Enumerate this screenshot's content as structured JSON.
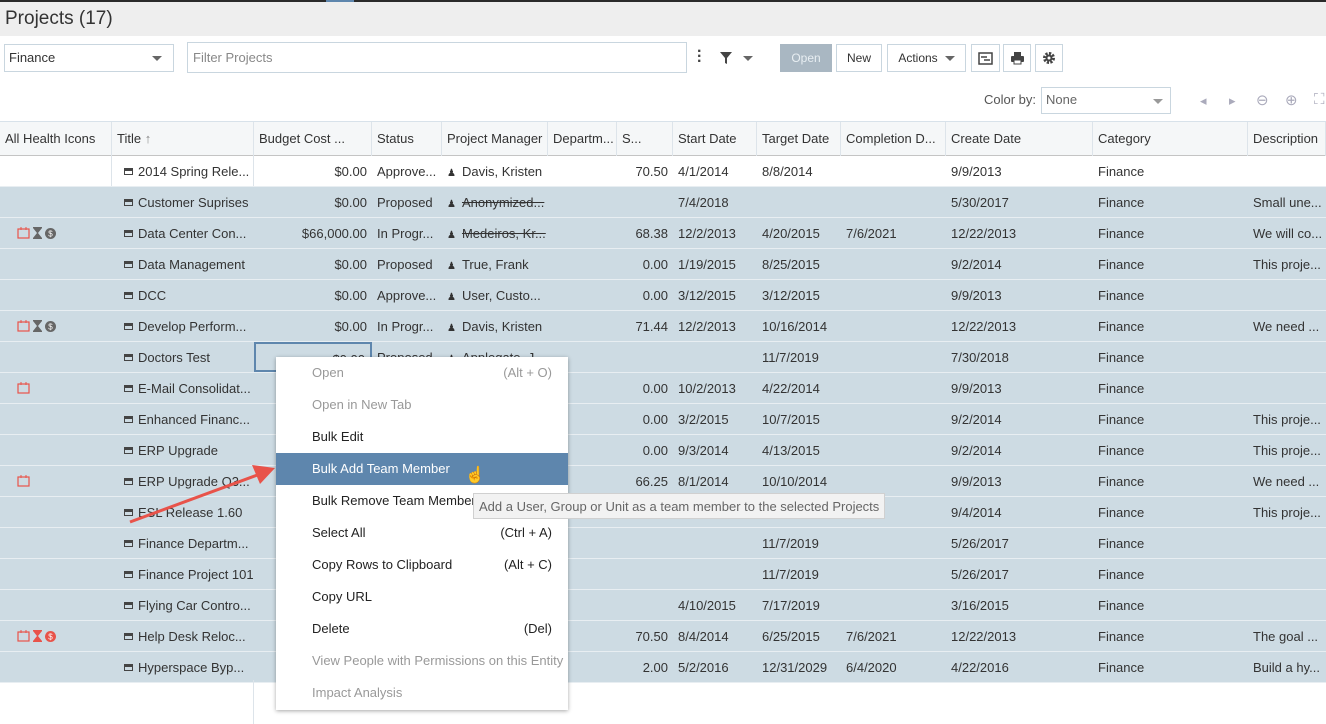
{
  "header": {
    "title": "Projects (17)"
  },
  "toolbar": {
    "view_select": "Finance",
    "filter_placeholder": "Filter Projects",
    "open_label": "Open",
    "new_label": "New",
    "actions_label": "Actions",
    "color_by_label": "Color by:",
    "color_by_value": "None"
  },
  "columns": [
    "All Health Icons",
    "Title",
    "Budget Cost ...",
    "Status",
    "Project Manager",
    "Departm...",
    "S...",
    "Start Date",
    "Target Date",
    "Completion D...",
    "Create Date",
    "Category",
    "Description"
  ],
  "colors": {
    "selected_row": "#cddbe3",
    "menu_highlight": "#5e86ad",
    "health_red": "#e8534a",
    "health_gray": "#666666"
  },
  "rows": [
    {
      "icons": [],
      "title": "2014 Spring Rele...",
      "budget": "$0.00",
      "status": "Approve...",
      "pm": "Davis, Kristen",
      "pm_strike": false,
      "dept": "",
      "s": "70.50",
      "start": "4/1/2014",
      "target": "8/8/2014",
      "completion": "",
      "create": "9/9/2013",
      "category": "Finance",
      "desc": "",
      "selected": false
    },
    {
      "icons": [],
      "title": "Customer Suprises",
      "budget": "$0.00",
      "status": "Proposed",
      "pm": "Anonymized...",
      "pm_strike": true,
      "dept": "",
      "s": "",
      "start": "7/4/2018",
      "target": "",
      "completion": "",
      "create": "5/30/2017",
      "category": "Finance",
      "desc": "Small une...",
      "selected": true
    },
    {
      "icons": [
        "calendar-red",
        "hourglass-gray",
        "dollar-gray"
      ],
      "title": "Data Center Con...",
      "budget": "$66,000.00",
      "status": "In Progr...",
      "pm": "Medeiros, Kr...",
      "pm_strike": true,
      "dept": "",
      "s": "68.38",
      "start": "12/2/2013",
      "target": "4/20/2015",
      "completion": "7/6/2021",
      "create": "12/22/2013",
      "category": "Finance",
      "desc": "We will co...",
      "selected": true
    },
    {
      "icons": [],
      "title": "Data Management",
      "budget": "$0.00",
      "status": "Proposed",
      "pm": "True, Frank",
      "pm_strike": false,
      "dept": "",
      "s": "0.00",
      "start": "1/19/2015",
      "target": "8/25/2015",
      "completion": "",
      "create": "9/2/2014",
      "category": "Finance",
      "desc": "This proje...",
      "selected": true
    },
    {
      "icons": [],
      "title": "DCC",
      "budget": "$0.00",
      "status": "Approve...",
      "pm": "User, Custo...",
      "pm_strike": false,
      "dept": "",
      "s": "0.00",
      "start": "3/12/2015",
      "target": "3/12/2015",
      "completion": "",
      "create": "9/9/2013",
      "category": "Finance",
      "desc": "",
      "selected": true
    },
    {
      "icons": [
        "calendar-red",
        "hourglass-gray",
        "dollar-gray"
      ],
      "title": "Develop Perform...",
      "budget": "$0.00",
      "status": "In Progr...",
      "pm": "Davis, Kristen",
      "pm_strike": false,
      "dept": "",
      "s": "71.44",
      "start": "12/2/2013",
      "target": "10/16/2014",
      "completion": "",
      "create": "12/22/2013",
      "category": "Finance",
      "desc": "We need ...",
      "selected": true
    },
    {
      "icons": [],
      "title": "Doctors Test",
      "budget": "$0.00",
      "status": "Proposed",
      "pm": "Applegate, J...",
      "pm_strike": false,
      "dept": "",
      "s": "",
      "start": "",
      "target": "11/7/2019",
      "completion": "",
      "create": "7/30/2018",
      "category": "Finance",
      "desc": "",
      "selected": true
    },
    {
      "icons": [
        "calendar-red"
      ],
      "title": "E-Mail Consolidat...",
      "budget": "",
      "status": "",
      "pm": "",
      "pm_strike": false,
      "dept": "",
      "s": "0.00",
      "start": "10/2/2013",
      "target": "4/22/2014",
      "completion": "",
      "create": "9/9/2013",
      "category": "Finance",
      "desc": "",
      "selected": true
    },
    {
      "icons": [],
      "title": "Enhanced Financ...",
      "budget": "",
      "status": "",
      "pm": "",
      "pm_strike": false,
      "dept": "",
      "s": "0.00",
      "start": "3/2/2015",
      "target": "10/7/2015",
      "completion": "",
      "create": "9/2/2014",
      "category": "Finance",
      "desc": "This proje...",
      "selected": true
    },
    {
      "icons": [],
      "title": "ERP Upgrade",
      "budget": "",
      "status": "",
      "pm": "",
      "pm_strike": false,
      "dept": "",
      "s": "0.00",
      "start": "9/3/2014",
      "target": "4/13/2015",
      "completion": "",
      "create": "9/2/2014",
      "category": "Finance",
      "desc": "This proje...",
      "selected": true
    },
    {
      "icons": [
        "calendar-red"
      ],
      "title": "ERP Upgrade Q3...",
      "budget": "",
      "status": "",
      "pm": "",
      "pm_strike": false,
      "dept": "",
      "s": "66.25",
      "start": "8/1/2014",
      "target": "10/10/2014",
      "completion": "",
      "create": "9/9/2013",
      "category": "Finance",
      "desc": "We need ...",
      "selected": true
    },
    {
      "icons": [],
      "title": "ESL Release 1.60",
      "budget": "",
      "status": "",
      "pm": "",
      "pm_strike": false,
      "dept": "",
      "s": "",
      "start": "",
      "target": "",
      "completion": "",
      "create": "9/4/2014",
      "category": "Finance",
      "desc": "This proje...",
      "selected": true
    },
    {
      "icons": [],
      "title": "Finance Departm...",
      "budget": "",
      "status": "",
      "pm": "",
      "pm_strike": false,
      "dept": "",
      "s": "",
      "start": "",
      "target": "11/7/2019",
      "completion": "",
      "create": "5/26/2017",
      "category": "Finance",
      "desc": "",
      "selected": true
    },
    {
      "icons": [],
      "title": "Finance Project 101",
      "budget": "",
      "status": "",
      "pm": "",
      "pm_strike": false,
      "dept": "",
      "s": "",
      "start": "",
      "target": "11/7/2019",
      "completion": "",
      "create": "5/26/2017",
      "category": "Finance",
      "desc": "",
      "selected": true
    },
    {
      "icons": [],
      "title": "Flying Car Contro...",
      "budget": "",
      "status": "",
      "pm": "",
      "pm_strike": false,
      "dept": "",
      "s": "",
      "start": "4/10/2015",
      "target": "7/17/2019",
      "completion": "",
      "create": "3/16/2015",
      "category": "Finance",
      "desc": "",
      "selected": true
    },
    {
      "icons": [
        "calendar-red",
        "hourglass-red",
        "dollar-red"
      ],
      "title": "Help Desk Reloc...",
      "budget": "",
      "status": "",
      "pm": "",
      "pm_strike": false,
      "dept": "",
      "s": "70.50",
      "start": "8/4/2014",
      "target": "6/25/2015",
      "completion": "7/6/2021",
      "create": "12/22/2013",
      "category": "Finance",
      "desc": "The goal ...",
      "selected": true
    },
    {
      "icons": [],
      "title": "Hyperspace Byp...",
      "budget": "",
      "status": "",
      "pm": "",
      "pm_strike": false,
      "dept": "",
      "s": "2.00",
      "start": "5/2/2016",
      "target": "12/31/2029",
      "completion": "6/4/2020",
      "create": "4/22/2016",
      "category": "Finance",
      "desc": "Build a hy...",
      "selected": true
    }
  ],
  "context_menu": {
    "items": [
      {
        "label": "Open",
        "shortcut": "(Alt + O)",
        "disabled": true
      },
      {
        "label": "Open in New Tab",
        "shortcut": "",
        "disabled": true
      },
      {
        "label": "Bulk Edit",
        "shortcut": "",
        "disabled": false
      },
      {
        "label": "Bulk Add Team Member",
        "shortcut": "",
        "disabled": false,
        "highlighted": true
      },
      {
        "label": "Bulk Remove Team Member",
        "shortcut": "",
        "disabled": false
      },
      {
        "label": "Select All",
        "shortcut": "(Ctrl + A)",
        "disabled": false
      },
      {
        "label": "Copy Rows to Clipboard",
        "shortcut": "(Alt + C)",
        "disabled": false
      },
      {
        "label": "Copy URL",
        "shortcut": "",
        "disabled": false
      },
      {
        "label": "Delete",
        "shortcut": "(Del)",
        "disabled": false
      },
      {
        "label": "View People with Permissions on this Entity",
        "shortcut": "",
        "disabled": true
      },
      {
        "label": "Impact Analysis",
        "shortcut": "",
        "disabled": true
      }
    ]
  },
  "tooltip": "Add a User, Group or Unit as a team member to the selected Projects"
}
